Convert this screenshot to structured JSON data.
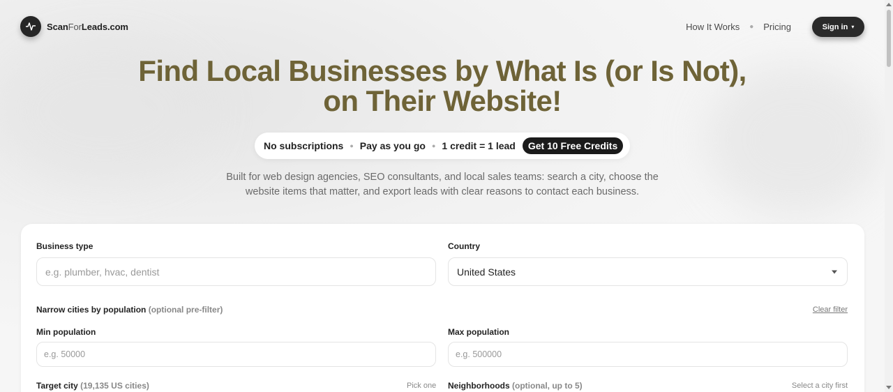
{
  "header": {
    "logo_name": "Scan",
    "logo_for": "For",
    "logo_rest": "Leads.com",
    "nav": [
      {
        "label": "How It Works"
      },
      {
        "label": "Pricing"
      }
    ],
    "signin_label": "Sign in"
  },
  "hero": {
    "title_line1": "Find Local Businesses by What Is (or Is Not),",
    "title_line2": "on Their Website!",
    "pill_items": [
      "No subscriptions",
      "Pay as you go",
      "1 credit = 1 lead"
    ],
    "cta_label": "Get 10 Free Credits",
    "subtitle_line1": "Built for web design agencies, SEO consultants, and local sales teams: search a city, choose the",
    "subtitle_line2": "website items that matter, and export leads with clear reasons to contact each business."
  },
  "form": {
    "business_type_label": "Business type",
    "business_type_placeholder": "e.g. plumber, hvac, dentist",
    "country_label": "Country",
    "country_value": "United States",
    "narrow_label": "Narrow cities by population",
    "narrow_optional": "(optional pre-filter)",
    "clear_filter": "Clear filter",
    "min_pop_label": "Min population",
    "min_pop_placeholder": "e.g. 50000",
    "max_pop_label": "Max population",
    "max_pop_placeholder": "e.g. 500000",
    "target_city_label": "Target city",
    "target_city_count": "(19,135 US cities)",
    "target_city_hint": "Pick one",
    "neighborhoods_label": "Neighborhoods",
    "neighborhoods_optional": "(optional, up to 5)",
    "neighborhoods_hint": "Select a city first"
  },
  "colors": {
    "title": "#6e6337",
    "dark": "#1b1b1b"
  }
}
